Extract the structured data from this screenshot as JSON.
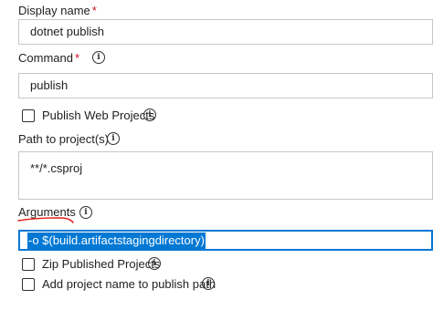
{
  "display_name": {
    "label": "Display name",
    "required_marker": "*",
    "value": "dotnet publish"
  },
  "command": {
    "label": "Command",
    "required_marker": "*",
    "value": "publish",
    "info_icon": "info-icon"
  },
  "publish_web_projects": {
    "label": "Publish Web Projects",
    "checked": false,
    "info_icon": "info-icon"
  },
  "path_to_projects": {
    "label": "Path to project(s)",
    "value": "**/*.csproj",
    "info_icon": "info-icon"
  },
  "arguments": {
    "label": "Arguments",
    "value": "-o $(build.artifactstagingdirectory)",
    "info_icon": "info-icon",
    "annotation_color": "#e0201b",
    "focus_color": "#0078d4"
  },
  "zip_published_projects": {
    "label": "Zip Published Projects",
    "checked": false,
    "info_icon": "info-icon"
  },
  "add_project_name": {
    "label": "Add project name to publish path",
    "checked": false,
    "info_icon": "info-icon"
  }
}
